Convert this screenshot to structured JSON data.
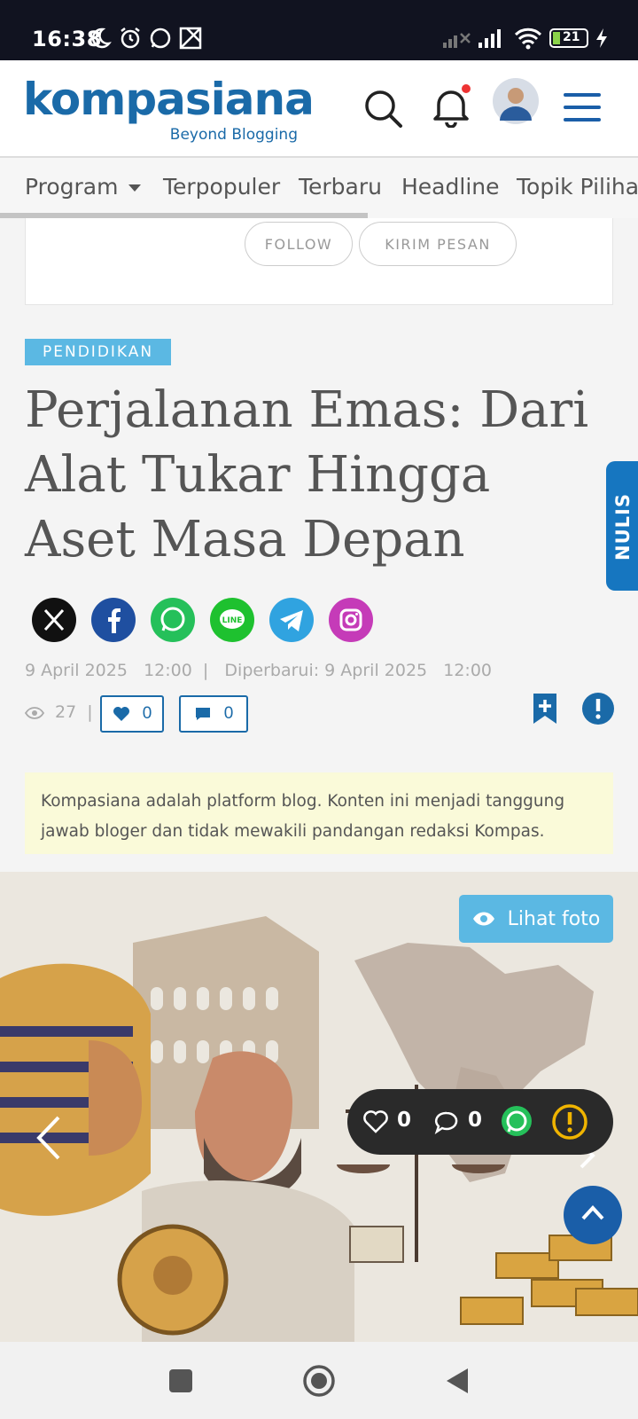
{
  "status_bar": {
    "time": "16:38",
    "battery": "21",
    "icons": [
      "moon-icon",
      "alarm-icon",
      "whatsapp-icon",
      "gallery-icon",
      "signal-off-icon",
      "signal-icon",
      "wifi-icon",
      "battery-icon",
      "charging-icon"
    ]
  },
  "header": {
    "logo_text": "kompasiana",
    "logo_tagline": "Beyond Blogging",
    "icons": [
      "search-icon",
      "bell-icon",
      "avatar",
      "menu-icon"
    ]
  },
  "nav": {
    "items": [
      "Program",
      "Terpopuler",
      "Terbaru",
      "Headline",
      "Topik Pilihan"
    ]
  },
  "author_card": {
    "follow_label": "FOLLOW",
    "message_label": "KIRIM PESAN"
  },
  "article": {
    "category": "PENDIDIKAN",
    "title": "Perjalanan Emas: Dari Alat Tukar Hingga Aset Masa Depan",
    "meta": "9 April 2025   12:00  |   Diperbarui: 9 April 2025   12:00",
    "views": "27",
    "views_sep": "|",
    "likes": "0",
    "comments": "0",
    "disclaimer": "Kompasiana adalah platform blog. Konten ini menjadi tanggung jawab bloger dan tidak mewakili pandangan redaksi Kompas."
  },
  "side_tab": {
    "label": "NULIS"
  },
  "share_icons": [
    "x-icon",
    "facebook-icon",
    "whatsapp-icon",
    "line-icon",
    "telegram-icon",
    "instagram-icon"
  ],
  "share_colors": [
    "#111111",
    "#1f4fa0",
    "#25c05a",
    "#1ec12f",
    "#30a3e0",
    "#c53bb8"
  ],
  "photo": {
    "view_label": "Lihat foto",
    "float_likes": "0",
    "float_comments": "0"
  },
  "colors": {
    "brand": "#1a6aa8",
    "category_bg": "#5bb8e3",
    "disclaimer_bg": "#fafad9",
    "nulis_bg": "#1676c0"
  }
}
